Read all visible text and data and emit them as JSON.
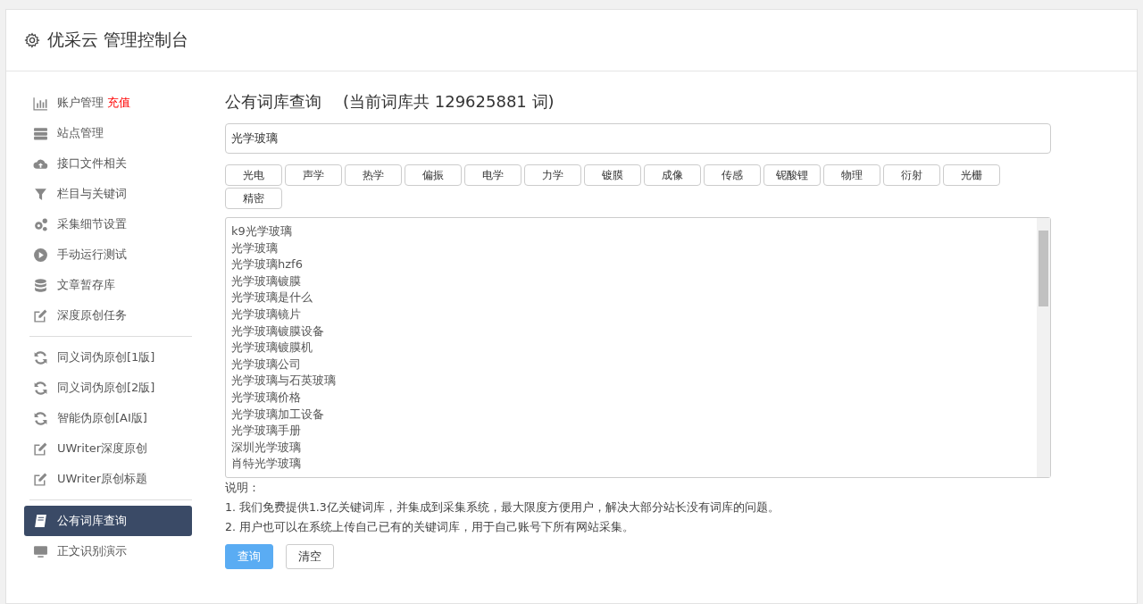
{
  "header": {
    "title": "优采云 管理控制台"
  },
  "sidebar": {
    "groups": [
      {
        "items": [
          {
            "label": "账户管理",
            "badge": "充值",
            "kind": "chart",
            "selected": false
          },
          {
            "label": "站点管理",
            "kind": "server",
            "selected": false
          },
          {
            "label": "接口文件相关",
            "kind": "cloud",
            "selected": false
          },
          {
            "label": "栏目与关键词",
            "kind": "filter",
            "selected": false
          },
          {
            "label": "采集细节设置",
            "kind": "gears",
            "selected": false
          },
          {
            "label": "手动运行测试",
            "kind": "play",
            "selected": false
          },
          {
            "label": "文章暂存库",
            "kind": "database",
            "selected": false
          },
          {
            "label": "深度原创任务",
            "kind": "edit",
            "selected": false
          }
        ]
      },
      {
        "items": [
          {
            "label": "同义词伪原创[1版]",
            "kind": "refresh",
            "selected": false
          },
          {
            "label": "同义词伪原创[2版]",
            "kind": "refresh",
            "selected": false
          },
          {
            "label": "智能伪原创[AI版]",
            "kind": "refresh",
            "selected": false
          },
          {
            "label": "UWriter深度原创",
            "kind": "edit",
            "selected": false
          },
          {
            "label": "UWriter原创标题",
            "kind": "edit",
            "selected": false
          }
        ]
      },
      {
        "items": [
          {
            "label": "公有词库查询",
            "kind": "book",
            "selected": true
          },
          {
            "label": "正文识别演示",
            "kind": "monitor",
            "selected": false
          }
        ]
      }
    ]
  },
  "main": {
    "title": "公有词库查询",
    "count_text": "(当前词库共 129625881 词)",
    "search": {
      "value": "光学玻璃"
    },
    "tags": [
      "光电",
      "声学",
      "热学",
      "偏振",
      "电学",
      "力学",
      "镀膜",
      "成像",
      "传感",
      "铌酸锂",
      "物理",
      "衍射",
      "光栅",
      "精密"
    ],
    "results": [
      "k9光学玻璃",
      "光学玻璃",
      "光学玻璃hzf6",
      "光学玻璃镀膜",
      "光学玻璃是什么",
      "光学玻璃镜片",
      "光学玻璃镀膜设备",
      "光学玻璃镀膜机",
      "光学玻璃公司",
      "光学玻璃与石英玻璃",
      "光学玻璃价格",
      "光学玻璃加工设备",
      "光学玻璃手册",
      "深圳光学玻璃",
      "肖特光学玻璃"
    ],
    "notes_title": "说明：",
    "notes": [
      "1. 我们免费提供1.3亿关键词库，并集成到采集系统，最大限度方便用户，解决大部分站长没有词库的问题。",
      "2. 用户也可以在系统上传自己已有的关键词库，用于自己账号下所有网站采集。"
    ],
    "buttons": [
      {
        "label": "查询",
        "kind": "primary"
      },
      {
        "label": "清空",
        "kind": "default"
      }
    ]
  }
}
